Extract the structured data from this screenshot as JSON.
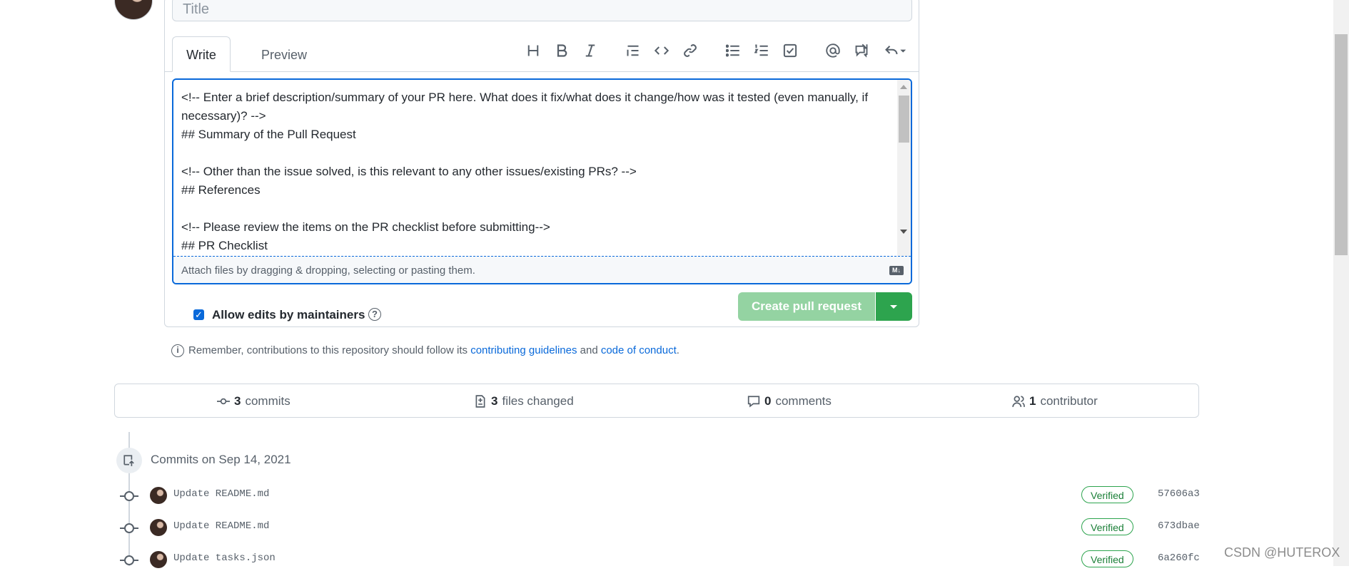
{
  "pr_form": {
    "title_placeholder": "Title",
    "tabs": {
      "write": "Write",
      "preview": "Preview"
    },
    "toolbar_icons": [
      "heading-icon",
      "bold-icon",
      "italic-icon",
      "quote-icon",
      "code-icon",
      "link-icon",
      "unordered-list-icon",
      "ordered-list-icon",
      "task-list-icon",
      "mention-icon",
      "reference-icon",
      "reply-icon"
    ],
    "body_text": "<!-- Enter a brief description/summary of your PR here. What does it fix/what does it change/how was it tested (even manually, if necessary)? -->\n## Summary of the Pull Request\n\n<!-- Other than the issue solved, is this relevant to any other issues/existing PRs? -->\n## References\n\n<!-- Please review the items on the PR checklist before submitting-->\n## PR Checklist",
    "attach_text": "Attach files by dragging & dropping, selecting or pasting them.",
    "markdown_badge": "M↓",
    "allow_edits_label": "Allow edits by maintainers",
    "allow_edits_checked": true,
    "help_glyph": "?",
    "create_button": "Create pull request",
    "notice": {
      "prefix": "Remember, contributions to this repository should follow its ",
      "link1": "contributing guidelines",
      "middle": " and ",
      "link2": "code of conduct",
      "suffix": "."
    }
  },
  "stats": {
    "commits_count": "3",
    "commits_label": "commits",
    "files_count": "3",
    "files_label": "files changed",
    "comments_count": "0",
    "comments_label": "comments",
    "contributors_count": "1",
    "contributors_label": "contributor"
  },
  "commits": {
    "date_heading": "Commits on Sep 14, 2021",
    "items": [
      {
        "message": "Update README.md",
        "badge": "Verified",
        "sha": "57606a3"
      },
      {
        "message": "Update README.md",
        "badge": "Verified",
        "sha": "673dbae"
      },
      {
        "message": "Update tasks.json",
        "badge": "Verified",
        "sha": "6a260fc"
      }
    ]
  },
  "colors": {
    "accent": "#0969da",
    "success": "#2da44e",
    "success_muted": "#94d3a2"
  },
  "watermark": "CSDN @HUTEROX"
}
